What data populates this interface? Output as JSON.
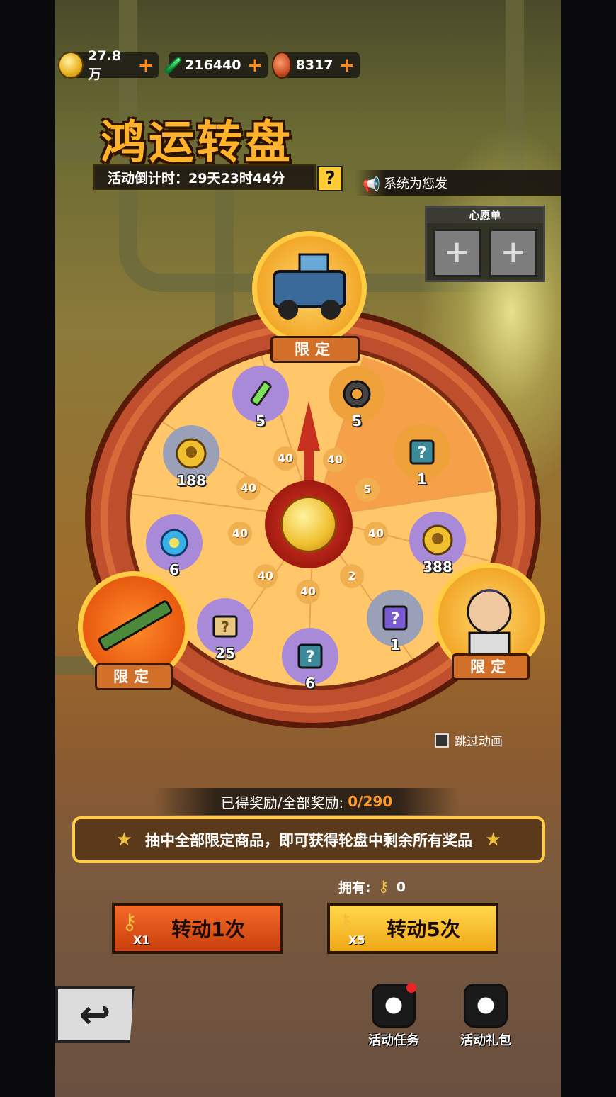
{
  "currencies": [
    {
      "icon": "gold-skull-coin-icon",
      "value": "27.8万",
      "plus": "+"
    },
    {
      "icon": "green-gem-icon",
      "value": "216440",
      "plus": "+"
    },
    {
      "icon": "meat-icon",
      "value": "8317",
      "plus": "+"
    }
  ],
  "title": "鸿运转盘",
  "countdown": "活动倒计时：29天23时44分",
  "help": "?",
  "broadcast": "系统为您发",
  "wishlist": {
    "label": "心愿单",
    "slot": "+"
  },
  "featured_label": "限定",
  "wheel": {
    "outer": [
      {
        "icon": "syringe-icon",
        "amount": "5",
        "color": "#a88ad8"
      },
      {
        "icon": "gear-part-icon",
        "amount": "5",
        "color": "#f0a23a"
      },
      {
        "icon": "mystery-card-icon",
        "amount": "1",
        "color": "#f0a23a"
      },
      {
        "icon": "gold-skull-coin-icon",
        "amount": "388",
        "color": "#a88ad8"
      },
      {
        "icon": "purple-card-icon",
        "amount": "1",
        "color": "#9aa0b8"
      },
      {
        "icon": "mystery-card-icon",
        "amount": "6",
        "color": "#a88ad8"
      },
      {
        "icon": "mystery-map-icon",
        "amount": "25",
        "color": "#a88ad8"
      },
      {
        "icon": "blue-gem-cluster-icon",
        "amount": "6",
        "color": "#a88ad8"
      },
      {
        "icon": "gold-skull-coin-icon",
        "amount": "188",
        "color": "#9aa0b8"
      }
    ],
    "inner": [
      "40",
      "40",
      "5",
      "40",
      "2",
      "40",
      "40",
      "40",
      "40",
      "40"
    ]
  },
  "skip_animation": "跳过动画",
  "progress": {
    "label": "已得奖励/全部奖励:",
    "value": "0/290"
  },
  "banner": "抽中全部限定商品，即可获得轮盘中剩余所有奖品",
  "owned": {
    "label": "拥有:",
    "value": "0"
  },
  "buttons": {
    "spin1": {
      "label": "转动1次",
      "mult": "X1"
    },
    "spin5": {
      "label": "转动5次",
      "mult": "X5"
    }
  },
  "nav": {
    "tasks": "活动任务",
    "gift": "活动礼包"
  }
}
